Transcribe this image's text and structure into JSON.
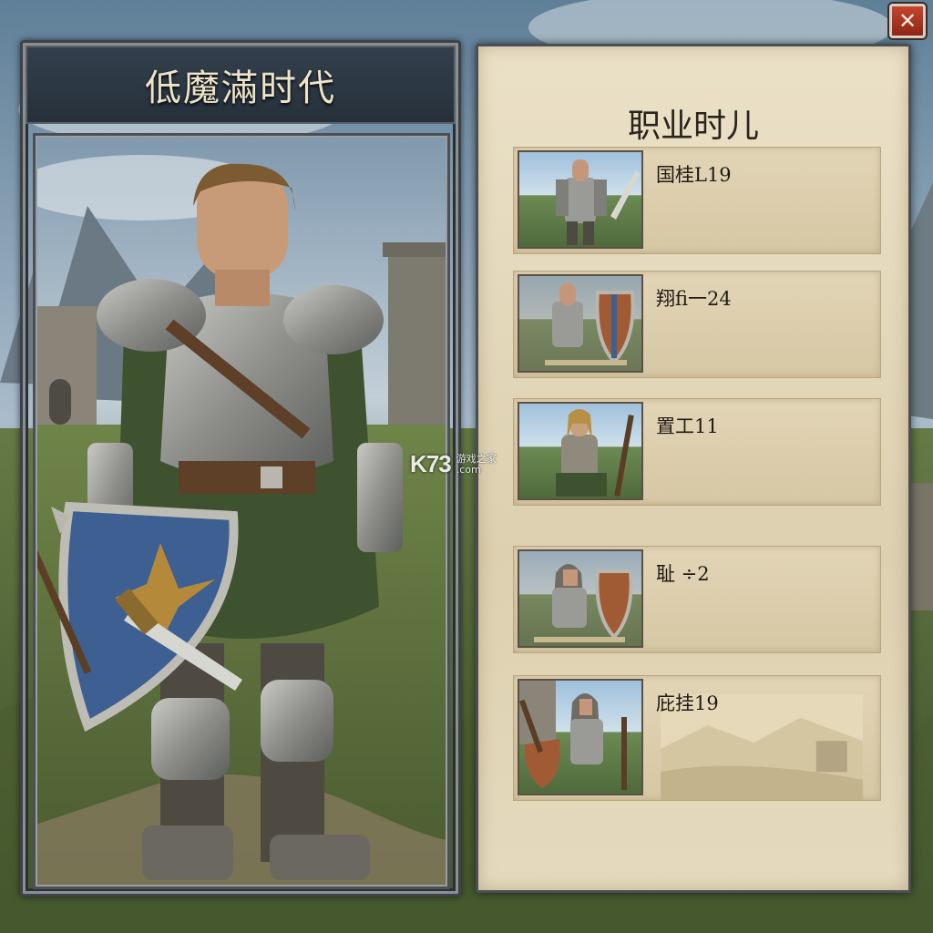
{
  "hero_panel": {
    "title": "低魔滿时代"
  },
  "class_panel": {
    "title": "职业时儿",
    "classes": [
      {
        "label": "国桂L19",
        "thumbnail": "knight-with-sword"
      },
      {
        "label": "翔fi一24",
        "thumbnail": "knight-with-shield"
      },
      {
        "label": "置工11",
        "thumbnail": "knight-with-staff"
      },
      {
        "label": "耻 ÷2",
        "thumbnail": "hooded-knight-with-shield"
      },
      {
        "label": "庇挂19",
        "thumbnail": "hooded-warrior-with-hammer"
      }
    ]
  },
  "close_button": {
    "icon": "close-icon",
    "glyph": "✕"
  },
  "watermark": {
    "logo": "K73",
    "line1": "游戏之家",
    "line2": ".com"
  },
  "colors": {
    "parchment": "#e2d5b6",
    "title_bar": "#2c3844",
    "close_red": "#b23a27",
    "frame": "#4a4f55"
  }
}
